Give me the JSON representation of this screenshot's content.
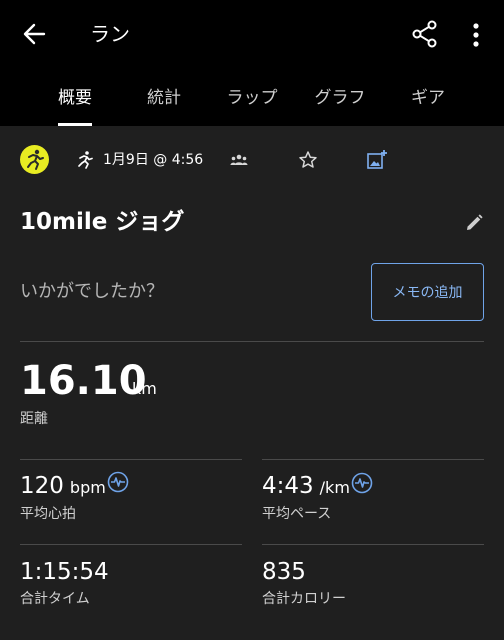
{
  "header": {
    "title": "ラン",
    "back_icon": "arrow-left-icon",
    "share_icon": "share-icon",
    "more_icon": "more-vertical-icon"
  },
  "tabs": [
    {
      "label": "概要",
      "active": true
    },
    {
      "label": "統計",
      "active": false
    },
    {
      "label": "ラップ",
      "active": false
    },
    {
      "label": "グラフ",
      "active": false
    },
    {
      "label": "ギア",
      "active": false
    }
  ],
  "meta": {
    "date": "1月9日 @ 4:56",
    "badge_color": "#e8ec22"
  },
  "activity": {
    "name": "10mile ジョグ"
  },
  "feedback": {
    "prompt": "いかがでしたか？",
    "memo_button": "メモの追加"
  },
  "distance": {
    "value": "16.10",
    "unit": "km",
    "label": "距離"
  },
  "stats": {
    "avg_hr": {
      "value": "120",
      "unit": "bpm",
      "label": "平均心拍"
    },
    "avg_pace": {
      "value": "4:43",
      "unit": "/km",
      "label": "平均ペース"
    },
    "total_time": {
      "value": "1:15:54",
      "label": "合計タイム"
    },
    "total_calories": {
      "value": "835",
      "label": "合計カロリー"
    }
  },
  "colors": {
    "accent": "#6fa3e8",
    "background": "#1f1f1f",
    "appbar": "#000000"
  }
}
